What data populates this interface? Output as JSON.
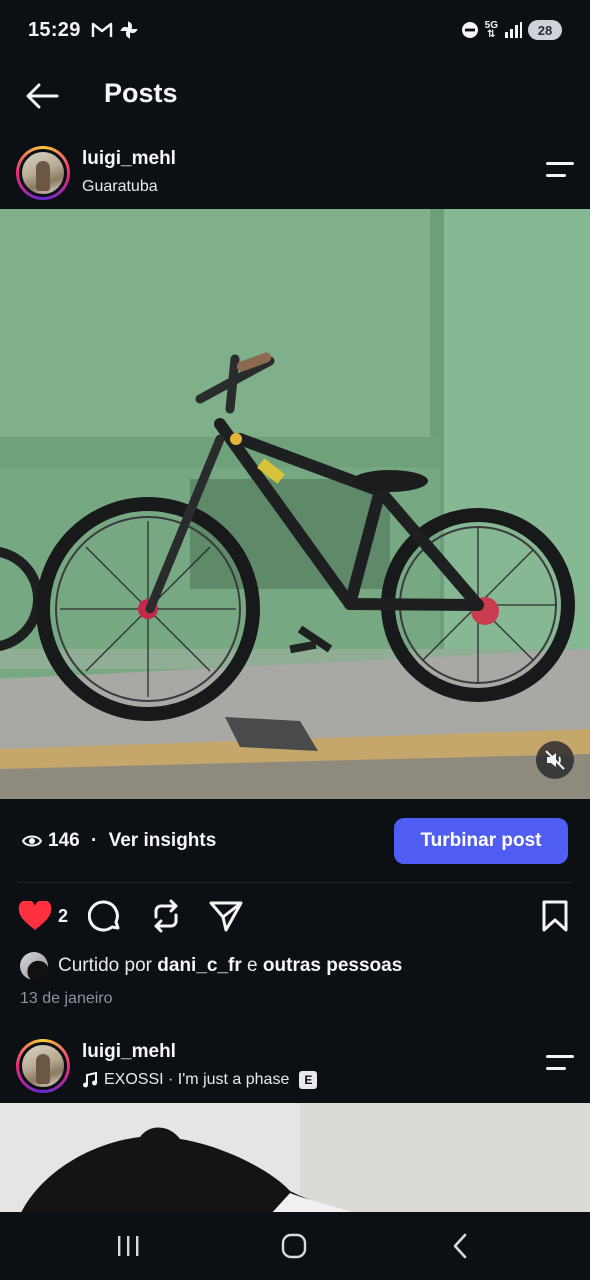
{
  "status_bar": {
    "time": "15:29",
    "notification_icons": [
      "gmail-icon",
      "pinwheel-icon"
    ],
    "status_icons": [
      "do-not-disturb-icon",
      "5g-icon",
      "signal-icon"
    ],
    "network_label": "5G",
    "battery": "28"
  },
  "header": {
    "title": "Posts",
    "back_icon": "arrow-left-icon"
  },
  "post": {
    "username": "luigi_mehl",
    "location": "Guaratuba",
    "image_description_icon": "photo",
    "views": "146",
    "insights_separator": " · ",
    "insights_label": "Ver insights",
    "boost_label": "Turbinar post",
    "likes_count": "2",
    "liked_by_prefix": "Curtido por",
    "liked_by_user": "dani_c_fr",
    "liked_by_joiner": "e",
    "liked_by_suffix": "outras pessoas",
    "date": "13 de janeiro",
    "colors": {
      "like": "#ff3040",
      "boost": "#4f5df3"
    }
  },
  "next_post": {
    "username": "luigi_mehl",
    "music_artist": "EXOSSI",
    "music_separator": " · ",
    "music_title": "I'm just a phase",
    "explicit_badge": "E"
  },
  "nav_bar": {
    "icons": [
      "recent-apps-icon",
      "home-icon",
      "back-icon"
    ]
  }
}
